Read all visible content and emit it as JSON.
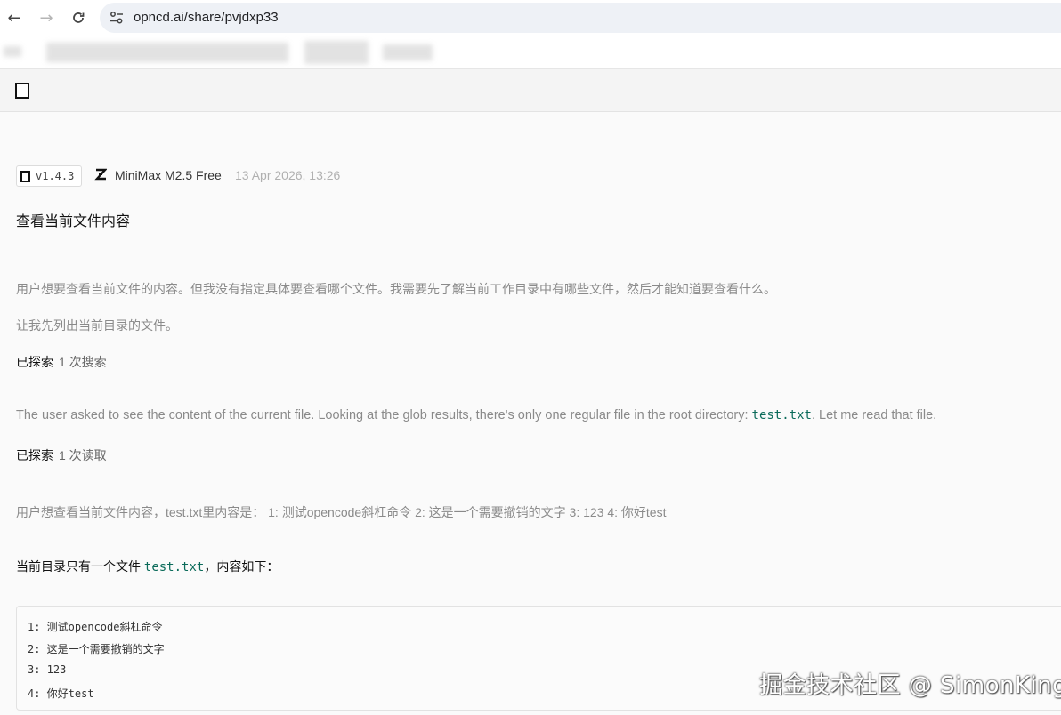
{
  "browser": {
    "url": "opncd.ai/share/pvjdxp33",
    "back_icon": "arrow-left-icon",
    "forward_icon": "arrow-right-icon",
    "reload_icon": "reload-icon"
  },
  "session": {
    "version": "v1.4.3",
    "model": "MiniMax M2.5 Free",
    "timestamp": "13 Apr 2026, 13:26"
  },
  "user_prompt": "查看当前文件内容",
  "messages": {
    "reasoning_1": "用户想要查看当前文件的内容。但我没有指定具体要查看哪个文件。我需要先了解当前工作目录中有哪些文件，然后才能知道要查看什么。",
    "reasoning_2": "让我先列出当前目录的文件。",
    "tool_1_label": "已探索",
    "tool_1_detail": "1 次搜索",
    "reasoning_en_prefix": "The user asked to see the content of the current file. Looking at the glob results, there's only one regular file in the root directory: ",
    "reasoning_en_code": "test.txt",
    "reasoning_en_suffix": ". Let me read that file.",
    "tool_2_label": "已探索",
    "tool_2_detail": "1 次读取",
    "reasoning_3": "用户想查看当前文件内容，test.txt里内容是： 1: 测试opencode斜杠命令 2: 这是一个需要撤销的文字 3: 123 4: 你好test",
    "answer_prefix": "当前目录只有一个文件 ",
    "answer_code": "test.txt",
    "answer_suffix": "，内容如下："
  },
  "code_block": {
    "lines": [
      "1: 测试opencode斜杠命令",
      "2: 这是一个需要撤销的文字",
      "3: 123",
      "4: 你好test"
    ]
  },
  "watermark": "掘金技术社区 @ SimonKing"
}
